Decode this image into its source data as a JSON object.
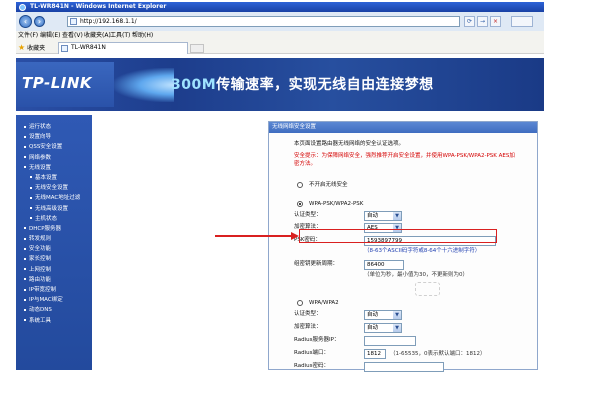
{
  "window": {
    "title": "TL-WR841N - Windows Internet Explorer",
    "address": "http://192.168.1.1/"
  },
  "toolbar": {
    "back": "‹",
    "forward": "›",
    "go": "→",
    "close": "×"
  },
  "menu": [
    "文件(F)",
    "编辑(E)",
    "查看(V)",
    "收藏夹(A)",
    "工具(T)",
    "帮助(H)"
  ],
  "favorites": {
    "label": "收藏夹",
    "tab": "TL-WR841N"
  },
  "banner": {
    "logo": "TP-LINK",
    "slogan_speed": "300M",
    "slogan_rest": "传输速率，实现无线自由连接梦想"
  },
  "sidebar": {
    "items": [
      {
        "label": "运行状态"
      },
      {
        "label": "设置向导"
      },
      {
        "label": "QSS安全设置"
      },
      {
        "label": "网络参数"
      },
      {
        "label": "无线设置"
      },
      {
        "label": "基本设置"
      },
      {
        "label": "无线安全设置"
      },
      {
        "label": "无线MAC地址过滤"
      },
      {
        "label": "无线高级设置"
      },
      {
        "label": "主机状态"
      },
      {
        "label": "DHCP服务器"
      },
      {
        "label": "转发规则"
      },
      {
        "label": "安全功能"
      },
      {
        "label": "家长控制"
      },
      {
        "label": "上网控制"
      },
      {
        "label": "路由功能"
      },
      {
        "label": "IP带宽控制"
      },
      {
        "label": "IP与MAC绑定"
      },
      {
        "label": "动态DNS"
      },
      {
        "label": "系统工具"
      }
    ]
  },
  "panel": {
    "title": "无线网络安全设置",
    "intro": "本页面设置路由器无线网络的安全认证选项。",
    "warning": "安全提示：为保障网络安全，强烈推荐开启安全设置，并使用WPA-PSK/WPA2-PSK AES加密方法。",
    "opt_none": "不开启无线安全",
    "opt_psk": "WPA-PSK/WPA2-PSK",
    "auth_label": "认证类型：",
    "auth_value": "自动",
    "enc_label": "加密算法：",
    "enc_value": "AES",
    "psk_label": "PSK密码：",
    "psk_value": "1593897799",
    "psk_hint": "（8-63个ASCII码字符或8-64个十六进制字符）",
    "renew_label": "组密钥更新周期：",
    "renew_value": "86400",
    "renew_hint": "（单位为秒，最小值为30，不更新则为0）",
    "opt_wpa": "WPA/WPA2",
    "auth2_label": "认证类型：",
    "auth2_value": "自动",
    "enc2_label": "加密算法：",
    "enc2_value": "自动",
    "radius_ip_label": "Radius服务器IP：",
    "radius_ip_value": "",
    "radius_port_label": "Radius端口：",
    "radius_port_value": "1812",
    "radius_port_hint": "（1-65535，0表示默认端口：1812）",
    "radius_pwd_label": "Radius密码：",
    "radius_pwd_value": ""
  }
}
